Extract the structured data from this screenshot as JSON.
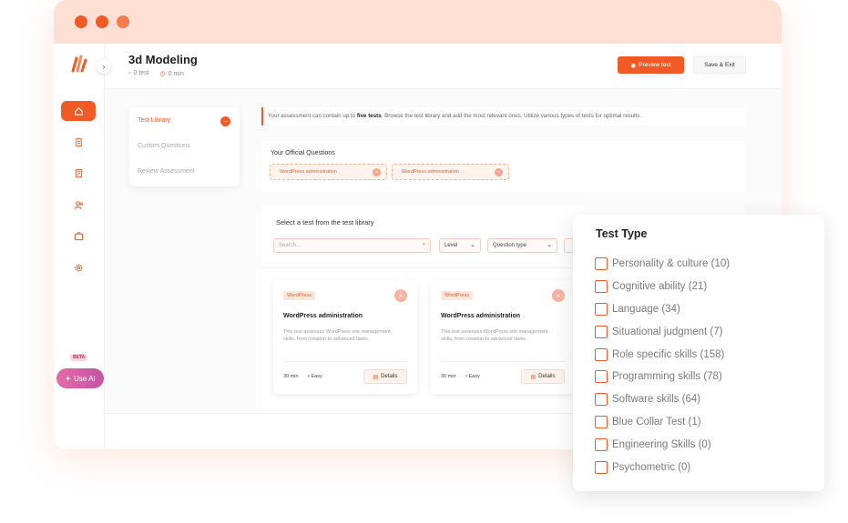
{
  "app": {
    "page_title": "3d Modeling",
    "test_count": "0 test",
    "duration": "0 min"
  },
  "header": {
    "preview_label": "Preview test",
    "save_label": "Save & Exit"
  },
  "sidebar": {
    "beta_label": "BETA",
    "use_ai_label": "Use AI"
  },
  "steps": [
    "Test Library",
    "Custom Questions",
    "Review Assessment"
  ],
  "notice": {
    "prefix": "Your assessment can contain up to ",
    "bold": "five tests",
    "suffix": ". Browse the test library and add the most relevant ones. Utilize various types of tests for optimal results ."
  },
  "official": {
    "title": "Your Official Questions",
    "chips": [
      "WordPress administration",
      "WordPress administration"
    ]
  },
  "library": {
    "title": "Select a test from the test library",
    "search_placeholder": "Search...",
    "filters": [
      "Level",
      "Question type"
    ],
    "cards": [
      {
        "tag": "WordPress",
        "name": "WordPress administration",
        "desc": "This test assesses WordPress site management skills, from creation to advanced tasks.",
        "duration": "30 min",
        "level": "Easy",
        "details": "Details"
      },
      {
        "tag": "WordPress",
        "name": "WordPress administration",
        "desc": "This test assesses WordPress site management skills, from creation to advanced tasks.",
        "duration": "30 min",
        "level": "Easy",
        "details": "Details"
      }
    ]
  },
  "test_type_panel": {
    "title": "Test Type",
    "options": [
      "Personality & culture (10)",
      "Cognitive ability (21)",
      "Language (34)",
      "Situational judgment (7)",
      "Role specific skills (158)",
      "Programming skills (78)",
      "Software skills (64)",
      "Blue Collar Test (1)",
      "Engineering Skills (0)",
      "Psychometric (0)"
    ]
  },
  "colors": {
    "accent": "#f15a24",
    "titlebar": "#fde0d3",
    "ai_gradient": "#c054a6"
  }
}
